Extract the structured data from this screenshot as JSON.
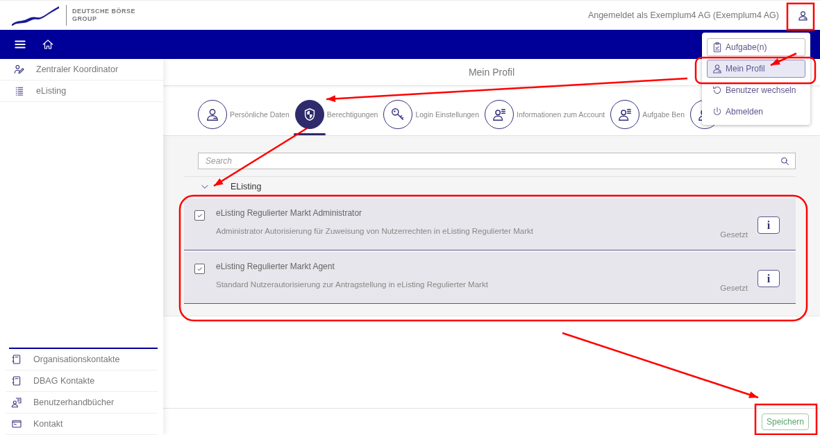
{
  "header": {
    "logo_lines": [
      "DEUTSCHE BÖRSE",
      "GROUP"
    ],
    "account_text": "Angemeldet als Exemplum4 AG (Exemplum4 AG)"
  },
  "sidebar": {
    "top_items": [
      {
        "label": "Zentraler Koordinator"
      },
      {
        "label": "eListing"
      }
    ],
    "bottom_items": [
      {
        "label": "Organisationskontakte"
      },
      {
        "label": "DBAG Kontakte"
      },
      {
        "label": "Benutzerhandbücher"
      },
      {
        "label": "Kontakt"
      }
    ]
  },
  "page_title": "Mein Profil",
  "tabs": [
    {
      "label": "Persönliche Daten",
      "selected": false
    },
    {
      "label": "Berechtigungen",
      "selected": true
    },
    {
      "label": "Login Einstellungen",
      "selected": false
    },
    {
      "label": "Informationen zum Account",
      "selected": false
    },
    {
      "label": "Aufgabe Ben",
      "selected": false
    },
    {
      "selected": false
    }
  ],
  "search": {
    "placeholder": "Search"
  },
  "group": {
    "label": "EListing",
    "expanded": true,
    "permissions": [
      {
        "checked": true,
        "title": "eListing Regulierter Markt Administrator",
        "description": "Administrator Autorisierung für Zuweisung von Nutzerrechten in eListing Regulierter Markt",
        "status": "Gesetzt",
        "info": "i"
      },
      {
        "checked": true,
        "title": "eListing Regulierter Markt Agent",
        "description": "Standard Nutzerautorisierung zur Antragstellung in eListing Regulierter Markt",
        "status": "Gesetzt",
        "info": "i"
      }
    ]
  },
  "save_button": "Speichern",
  "user_menu": {
    "items": [
      {
        "label": "Aufgabe(n)",
        "selected": false,
        "focused": true
      },
      {
        "label": "Mein Profil",
        "selected": true,
        "focused": false
      },
      {
        "label": "Benutzer wechseln",
        "selected": false,
        "focused": false
      },
      {
        "label": "Abmelden",
        "selected": false,
        "focused": false
      }
    ]
  }
}
